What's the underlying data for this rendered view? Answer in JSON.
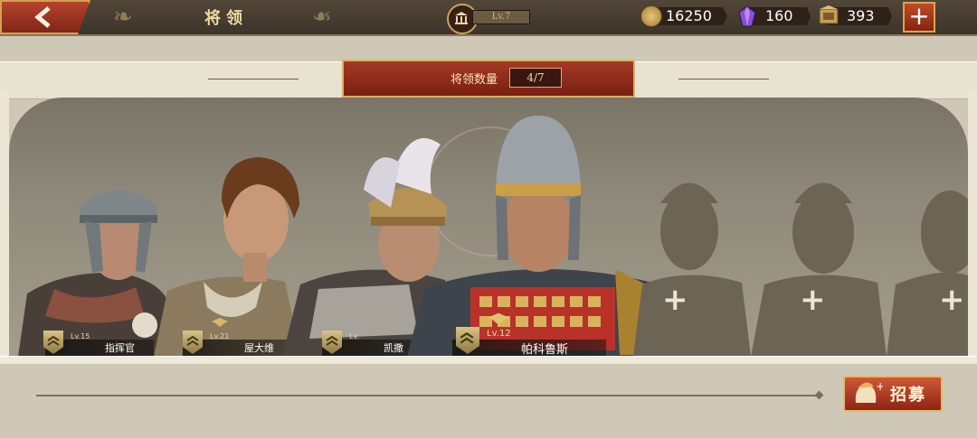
{
  "header": {
    "title": "将领",
    "level": "Lv.7"
  },
  "resources": {
    "coins": "16250",
    "gems": "160",
    "books": "393"
  },
  "roster": {
    "count_label": "将领数量",
    "count_value": "4/7"
  },
  "generals": [
    {
      "name": "指挥官",
      "level": "Lv.15"
    },
    {
      "name": "屋大维",
      "level": "Lv.21"
    },
    {
      "name": "凯撒",
      "level": "Lv."
    },
    {
      "name": "帕科鲁斯",
      "level": "Lv.12"
    }
  ],
  "recruit": {
    "label": "招募"
  },
  "colors": {
    "accent_red": "#a33a24",
    "gold": "#d7b067",
    "panel": "#8f8a7b"
  }
}
